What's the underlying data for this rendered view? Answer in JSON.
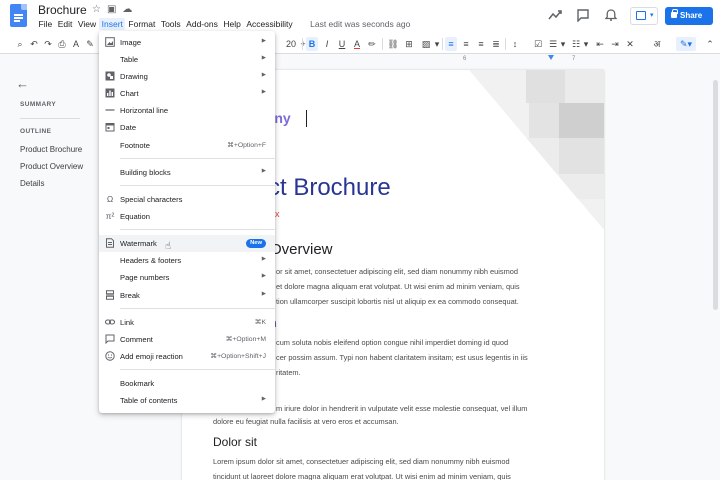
{
  "window": {
    "doc_title": "Brochure",
    "last_edit": "Last edit was seconds ago",
    "share_label": "Share"
  },
  "menubar": [
    "File",
    "Edit",
    "View",
    "Insert",
    "Format",
    "Tools",
    "Add-ons",
    "Help",
    "Accessibility"
  ],
  "toolbar": {
    "font_size": "20"
  },
  "ruler": {
    "marks": [
      "6",
      "7"
    ]
  },
  "outline": {
    "summary_heading": "SUMMARY",
    "outline_heading": "OUTLINE",
    "items": [
      "Product Brochure",
      "Product Overview",
      "Details"
    ]
  },
  "insert_menu": {
    "items": [
      {
        "label": "Image",
        "icon": "image-icon",
        "arrow": true
      },
      {
        "label": "Table",
        "icon": "",
        "arrow": true
      },
      {
        "label": "Drawing",
        "icon": "drawing-icon",
        "arrow": true
      },
      {
        "label": "Chart",
        "icon": "chart-icon",
        "arrow": true
      },
      {
        "label": "Horizontal line",
        "icon": "horizontal-line-icon"
      },
      {
        "label": "Date",
        "icon": "date-icon"
      },
      {
        "label": "Footnote",
        "icon": "",
        "shortcut": "⌘+Option+F"
      },
      {
        "label": "Building blocks",
        "icon": "",
        "arrow": true
      },
      {
        "label": "Special characters",
        "icon": "omega-icon"
      },
      {
        "label": "Equation",
        "icon": "equation-icon"
      },
      {
        "label": "Watermark",
        "icon": "watermark-icon",
        "badge": "New"
      },
      {
        "label": "Headers & footers",
        "icon": "",
        "arrow": true
      },
      {
        "label": "Page numbers",
        "icon": "",
        "arrow": true
      },
      {
        "label": "Break",
        "icon": "break-icon",
        "arrow": true
      },
      {
        "label": "Link",
        "icon": "link-icon",
        "shortcut": "⌘K"
      },
      {
        "label": "Comment",
        "icon": "comment-icon",
        "shortcut": "⌘+Option+M"
      },
      {
        "label": "Add emoji reaction",
        "icon": "emoji-icon",
        "shortcut": "⌘+Option+Shift+J"
      },
      {
        "label": "Bookmark",
        "icon": ""
      },
      {
        "label": "Table of contents",
        "icon": "",
        "arrow": true
      }
    ]
  },
  "document": {
    "company": "pany",
    "title": "ct Brochure",
    "subtitle": "xx",
    "overview_heading": "Overview",
    "overview_lines": [
      "or sit amet, consectetuer adipiscing elit, sed diam nonummy nibh euismod",
      "et dolore magna aliquam erat volutpat. Ut wisi enim ad minim veniam, quis",
      "tion ullamcorper suscipit lobortis nisl ut aliquip ex ea commodo consequat."
    ],
    "section2_heading": "n",
    "section2_lines": [
      "cum soluta nobis eleifend option congue nihil imperdiet doming id quod",
      "cer possim assum. Typi non habent claritatem insitam; est usus legentis in iis",
      "ritatem."
    ],
    "section3_lines": [
      "m iriure dolor in hendrerit in vulputate velit esse molestie consequat, vel illum",
      "dolore eu feugiat nulla facilisis at vero eros et accumsan."
    ],
    "dolor_heading": "Dolor sit",
    "dolor_lines": [
      "Lorem ipsum dolor sit amet, consectetuer adipiscing elit, sed diam nonummy nibh euismod",
      "tincidunt ut laoreet dolore magna aliquam erat volutpat. Ut wisi enim ad minim veniam, quis"
    ]
  },
  "colors": {
    "accent": "#1a73e8",
    "doc_title_color": "#283593",
    "company_color": "#7b6bd6"
  }
}
